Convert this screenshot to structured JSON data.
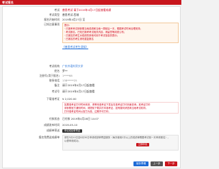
{
  "header": {
    "title": "考试报名"
  },
  "fields": {
    "exam_label": "考试",
    "exam_value": "普思考试 请于2019年4月17日起查看成绩",
    "exam_type_label": "考试类型",
    "exam_type_value": "普思考试-西城",
    "reg_start_label": "报名开始时间",
    "reg_start_value": "2019年4月27日 至",
    "notice_label": "已知注意事项",
    "notice_heading": "提示：",
    "notice_lines": [
      "· 已报考考试请参照当地成绩和当地一周前后一天，根据考试时间合理安排；",
      "· 考试报名，已知已报考考试相关内容，请留意等成绩公布；",
      "· 已报名的考生对成绩的其他可用于考试信息的提示；",
      "· 已报名的考生请勿重复报名"
    ],
    "link_text": "《普思考试考生须知》",
    "school_label": "考试机构",
    "school_value": "广东外语外贸大学",
    "name_label": "姓名",
    "name_value": "罗**",
    "id_label": "注册号(用于报名)",
    "id_value": "1****68",
    "phone_label": "联系电话",
    "phone_value": "138*****25",
    "note_label": "备注",
    "note_value": "请于2019年4月17日起查看",
    "exam_no_label": "考试号",
    "exam_no_value": "请于2019年4月17日起查看",
    "fee_label": "下载准考证",
    "fee_value": "¥ 2,020.00",
    "fee_lines": [
      "如果准考证打印时间未到，请等待准考证下发后在准考证打印页面查询；准考证打印",
      "请参照官方通知时间，请提前下载并打印准考证，如有疑问请咨询当地考试机构，",
      "打印准考证时间以官方为准，过期不可打印。"
    ],
    "pay_label": "付款状态",
    "pay_value": "已付款 2019年4月28日 14:07",
    "result_label": "成绩发布时间",
    "result_value": "2019-05-10",
    "report_label": "成绩单寄送",
    "report_button": "申请成绩单寄送",
    "extra_label": "报名免费送成绩单",
    "extra_lines": [
      "请在5月10日至6月30日申请成绩单寄送服务（每次使用2次以上的成绩单需要考试前一天申请报名），",
      "以便申请成功。"
    ],
    "extra_button": "立即申请"
  },
  "footer": {
    "btn_save": "保存草稿",
    "btn_prev": "上一步",
    "btn_next": "下一步"
  }
}
